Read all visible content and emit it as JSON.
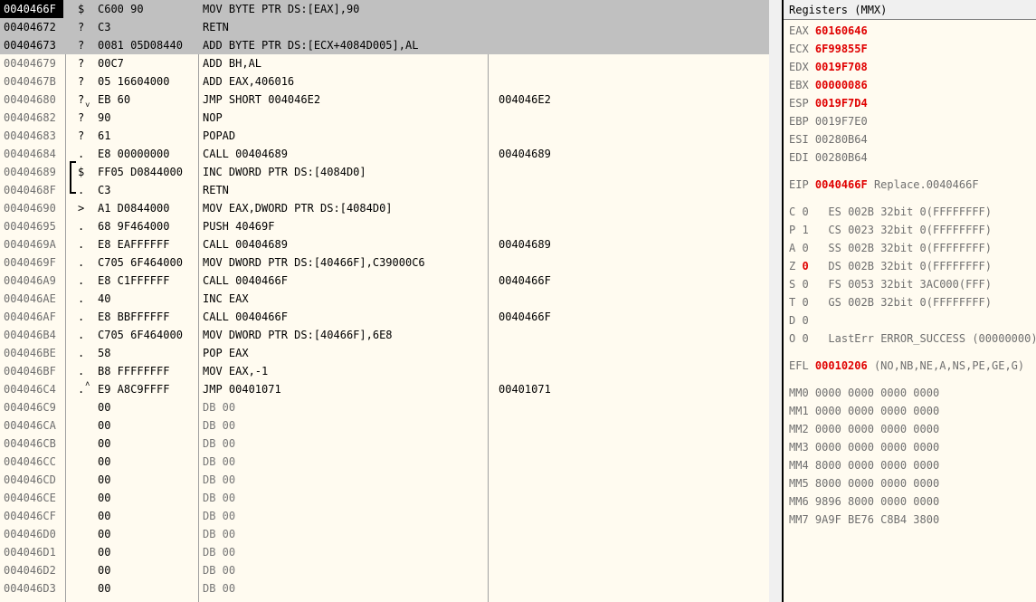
{
  "disassembly": {
    "rows": [
      {
        "addr": "0040466F",
        "mark": "$",
        "bytes": "C600 90",
        "instr": "MOV BYTE PTR DS:[EAX],90",
        "comment": ""
      },
      {
        "addr": "00404672",
        "mark": "?",
        "bytes": "C3",
        "instr": "RETN",
        "comment": ""
      },
      {
        "addr": "00404673",
        "mark": "?",
        "bytes": "0081 05D08440",
        "instr": "ADD BYTE PTR DS:[ECX+4084D005],AL",
        "comment": ""
      },
      {
        "addr": "00404679",
        "mark": "?",
        "bytes": "00C7",
        "instr": "ADD BH,AL",
        "comment": ""
      },
      {
        "addr": "0040467B",
        "mark": "?",
        "bytes": "05 16604000",
        "instr": "ADD EAX,406016",
        "comment": ""
      },
      {
        "addr": "00404680",
        "mark": "?",
        "bytes": "EB 60",
        "instr": "JMP SHORT 004046E2",
        "comment": "004046E2"
      },
      {
        "addr": "00404682",
        "mark": "?",
        "bytes": "90",
        "instr": "NOP",
        "comment": ""
      },
      {
        "addr": "00404683",
        "mark": "?",
        "bytes": "61",
        "instr": "POPAD",
        "comment": ""
      },
      {
        "addr": "00404684",
        "mark": ".",
        "bytes": "E8 00000000",
        "instr": "CALL 00404689",
        "comment": "00404689"
      },
      {
        "addr": "00404689",
        "mark": "$",
        "bytes": "FF05 D0844000",
        "instr": "INC DWORD PTR DS:[4084D0]",
        "comment": ""
      },
      {
        "addr": "0040468F",
        "mark": ".",
        "bytes": "C3",
        "instr": "RETN",
        "comment": ""
      },
      {
        "addr": "00404690",
        "mark": ">",
        "bytes": "A1 D0844000",
        "instr": "MOV EAX,DWORD PTR DS:[4084D0]",
        "comment": ""
      },
      {
        "addr": "00404695",
        "mark": ".",
        "bytes": "68 9F464000",
        "instr": "PUSH 40469F",
        "comment": ""
      },
      {
        "addr": "0040469A",
        "mark": ".",
        "bytes": "E8 EAFFFFFF",
        "instr": "CALL 00404689",
        "comment": "00404689"
      },
      {
        "addr": "0040469F",
        "mark": ".",
        "bytes": "C705 6F464000",
        "instr": "MOV DWORD PTR DS:[40466F],C39000C6",
        "comment": ""
      },
      {
        "addr": "004046A9",
        "mark": ".",
        "bytes": "E8 C1FFFFFF",
        "instr": "CALL 0040466F",
        "comment": "0040466F"
      },
      {
        "addr": "004046AE",
        "mark": ".",
        "bytes": "40",
        "instr": "INC EAX",
        "comment": ""
      },
      {
        "addr": "004046AF",
        "mark": ".",
        "bytes": "E8 BBFFFFFF",
        "instr": "CALL 0040466F",
        "comment": "0040466F"
      },
      {
        "addr": "004046B4",
        "mark": ".",
        "bytes": "C705 6F464000",
        "instr": "MOV DWORD PTR DS:[40466F],6E8",
        "comment": ""
      },
      {
        "addr": "004046BE",
        "mark": ".",
        "bytes": "58",
        "instr": "POP EAX",
        "comment": ""
      },
      {
        "addr": "004046BF",
        "mark": ".",
        "bytes": "B8 FFFFFFFF",
        "instr": "MOV EAX,-1",
        "comment": ""
      },
      {
        "addr": "004046C4",
        "mark": ".",
        "bytes": "E9 A8C9FFFF",
        "instr": "JMP 00401071",
        "comment": "00401071"
      },
      {
        "addr": "004046C9",
        "mark": "",
        "bytes": "00",
        "instr": "DB 00",
        "comment": ""
      },
      {
        "addr": "004046CA",
        "mark": "",
        "bytes": "00",
        "instr": "DB 00",
        "comment": ""
      },
      {
        "addr": "004046CB",
        "mark": "",
        "bytes": "00",
        "instr": "DB 00",
        "comment": ""
      },
      {
        "addr": "004046CC",
        "mark": "",
        "bytes": "00",
        "instr": "DB 00",
        "comment": ""
      },
      {
        "addr": "004046CD",
        "mark": "",
        "bytes": "00",
        "instr": "DB 00",
        "comment": ""
      },
      {
        "addr": "004046CE",
        "mark": "",
        "bytes": "00",
        "instr": "DB 00",
        "comment": ""
      },
      {
        "addr": "004046CF",
        "mark": "",
        "bytes": "00",
        "instr": "DB 00",
        "comment": ""
      },
      {
        "addr": "004046D0",
        "mark": "",
        "bytes": "00",
        "instr": "DB 00",
        "comment": ""
      },
      {
        "addr": "004046D1",
        "mark": "",
        "bytes": "00",
        "instr": "DB 00",
        "comment": ""
      },
      {
        "addr": "004046D2",
        "mark": "",
        "bytes": "00",
        "instr": "DB 00",
        "comment": ""
      },
      {
        "addr": "004046D3",
        "mark": "",
        "bytes": "00",
        "instr": "DB 00",
        "comment": ""
      }
    ]
  },
  "registers": {
    "title": "Registers (MMX)",
    "general": [
      {
        "name": "EAX",
        "value": "60160646",
        "changed": true,
        "extra": ""
      },
      {
        "name": "ECX",
        "value": "6F99855F",
        "changed": true,
        "extra": ""
      },
      {
        "name": "EDX",
        "value": "0019F708",
        "changed": true,
        "extra": ""
      },
      {
        "name": "EBX",
        "value": "00000086",
        "changed": true,
        "extra": ""
      },
      {
        "name": "ESP",
        "value": "0019F7D4",
        "changed": true,
        "extra": ""
      },
      {
        "name": "EBP",
        "value": "0019F7E0",
        "changed": false,
        "extra": ""
      },
      {
        "name": "ESI",
        "value": "00280B64",
        "changed": false,
        "extra": ""
      },
      {
        "name": "EDI",
        "value": "00280B64",
        "changed": false,
        "extra": ""
      }
    ],
    "eip": {
      "name": "EIP",
      "value": "0040466F",
      "changed": true,
      "extra": "Replace.0040466F"
    },
    "flags": [
      {
        "name": "C",
        "value": "0",
        "changed": false,
        "extra": "ES 002B 32bit 0(FFFFFFFF)"
      },
      {
        "name": "P",
        "value": "1",
        "changed": false,
        "extra": "CS 0023 32bit 0(FFFFFFFF)"
      },
      {
        "name": "A",
        "value": "0",
        "changed": false,
        "extra": "SS 002B 32bit 0(FFFFFFFF)"
      },
      {
        "name": "Z",
        "value": "0",
        "changed": true,
        "extra": "DS 002B 32bit 0(FFFFFFFF)"
      },
      {
        "name": "S",
        "value": "0",
        "changed": false,
        "extra": "FS 0053 32bit 3AC000(FFF)"
      },
      {
        "name": "T",
        "value": "0",
        "changed": false,
        "extra": "GS 002B 32bit 0(FFFFFFFF)"
      },
      {
        "name": "D",
        "value": "0",
        "changed": false,
        "extra": ""
      },
      {
        "name": "O",
        "value": "0",
        "changed": false,
        "extra": "LastErr ERROR_SUCCESS (00000000)"
      }
    ],
    "efl": {
      "name": "EFL",
      "value": "00010206",
      "changed": true,
      "extra": "(NO,NB,NE,A,NS,PE,GE,G)"
    },
    "mmx": [
      {
        "name": "MM0",
        "value": "0000 0000 0000 0000"
      },
      {
        "name": "MM1",
        "value": "0000 0000 0000 0000"
      },
      {
        "name": "MM2",
        "value": "0000 0000 0000 0000"
      },
      {
        "name": "MM3",
        "value": "0000 0000 0000 0000"
      },
      {
        "name": "MM4",
        "value": "8000 0000 0000 0000"
      },
      {
        "name": "MM5",
        "value": "8000 0000 0000 0000"
      },
      {
        "name": "MM6",
        "value": "9896 8000 0000 0000"
      },
      {
        "name": "MM7",
        "value": "9A9F BE76 C8B4 3800"
      }
    ]
  },
  "colors": {
    "changed": "#e00000",
    "selected_bg": "#c0c0c0",
    "pane_bg": "#fffbf0"
  }
}
